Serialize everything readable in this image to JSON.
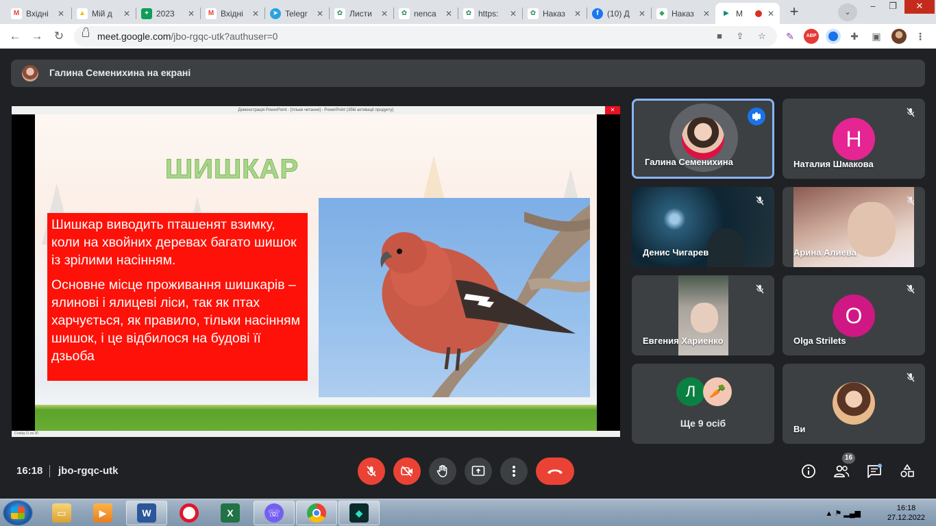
{
  "browser": {
    "tabs": [
      {
        "label": "Вхідні",
        "icon": "gmail-icon",
        "color": "#ea4335",
        "glyph": "M"
      },
      {
        "label": "Мій д",
        "icon": "google-drive-icon",
        "color": "#fbbc04",
        "glyph": "▲"
      },
      {
        "label": "2023",
        "icon": "google-sheets-icon",
        "color": "#0f9d58",
        "glyph": "+"
      },
      {
        "label": "Вхідні",
        "icon": "gmail-icon",
        "color": "#ea4335",
        "glyph": "M"
      },
      {
        "label": "Telegr",
        "icon": "telegram-icon",
        "color": "#2aa3e0",
        "glyph": "➤"
      },
      {
        "label": "Листи",
        "icon": "globe-icon",
        "color": "#2e8b57",
        "glyph": "✿"
      },
      {
        "label": "nenca",
        "icon": "globe-icon",
        "color": "#2e8b57",
        "glyph": "✿"
      },
      {
        "label": "https:",
        "icon": "globe-icon",
        "color": "#2e8b57",
        "glyph": "✿"
      },
      {
        "label": "Наказ",
        "icon": "globe-icon",
        "color": "#2e8b57",
        "glyph": "✿"
      },
      {
        "label": "(10) Д",
        "icon": "facebook-icon",
        "color": "#1877f2",
        "glyph": "f"
      },
      {
        "label": "Наказ",
        "icon": "shield-icon",
        "color": "#34a853",
        "glyph": "◆"
      },
      {
        "label": "M",
        "icon": "google-meet-icon",
        "color": "#00897b",
        "glyph": "▶"
      }
    ],
    "url_host": "meet.google.com",
    "url_path": "/jbo-rgqc-utk?authuser=0"
  },
  "meet": {
    "presenting_text": "Галина Семенихина на екрані",
    "time": "16:18",
    "meeting_code": "jbo-rgqc-utk",
    "participant_count": "16"
  },
  "slide": {
    "window_title": "Демонстрація PowerPoint - [тільки читання] - PowerPoint (Збій активації продукту)",
    "title": "ШИШКАР",
    "paragraph1": "Шишкар виводить пташенят взимку, коли на хвойних деревах багато шишок із зрілими насінням.",
    "paragraph2": "Основне місце проживання шишкарів  – ялинові і ялицеві ліси, так як птах харчується, як правило, тільки насінням шишок, і це відбилося на будові її дзьоба",
    "status": "Слайд 11 из 30"
  },
  "participants": [
    {
      "name": "Галина Семенихина",
      "speaking": true
    },
    {
      "name": "Наталия Шмакова",
      "letter": "Н",
      "color": "#e52592"
    },
    {
      "name": "Денис Чигарев"
    },
    {
      "name": "Арина Алиева"
    },
    {
      "name": "Евгения Хариенко"
    },
    {
      "name": "Olga Strilets",
      "letter": "O",
      "color": "#d01884"
    },
    {
      "name": "Ще 9 осіб",
      "letter": "Л",
      "color": "#0b8043"
    },
    {
      "name": "Ви"
    }
  ],
  "taskbar": {
    "time": "16:18",
    "date": "27.12.2022"
  },
  "colors": {
    "meet_bg": "#202124",
    "tile_bg": "#3c4043",
    "hangup": "#ea4335",
    "accent": "#8ab4f8"
  }
}
